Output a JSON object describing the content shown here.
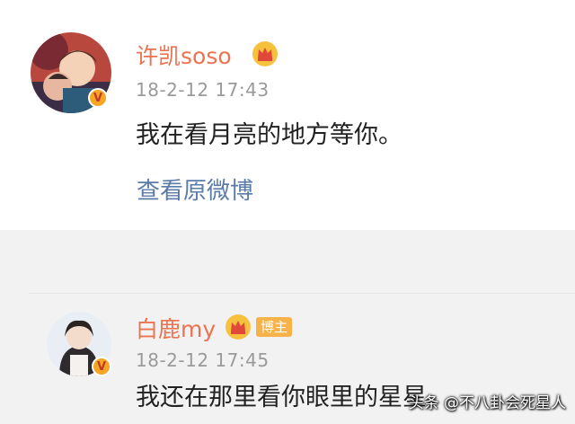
{
  "post": {
    "username": "许凯soso",
    "timestamp": "18-2-12 17:43",
    "text": "我在看月亮的地方等你。",
    "view_original_label": "查看原微博",
    "verified_icon": "v-verified-badge",
    "vip_icon": "crown-icon"
  },
  "reply": {
    "username": "白鹿my",
    "tag_label": "博主",
    "timestamp": "18-2-12 17:45",
    "text": "我还在那里看你眼里的星星",
    "verified_icon": "v-verified-badge",
    "vip_icon": "crown-icon"
  },
  "badge_letter": "V",
  "watermark": "头条 @不八卦会死星人",
  "colors": {
    "username": "#eb7350",
    "link": "#5b7ba8",
    "timestamp": "#9a9a9a",
    "reply_background": "#f2f2f2",
    "badge": "#f5a623"
  }
}
